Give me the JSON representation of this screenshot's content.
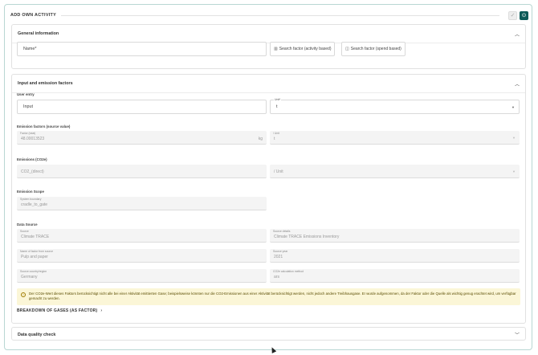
{
  "header": {
    "title": "ADD OWN ACTIVITY",
    "check_icon": "check-icon",
    "save_icon": "save-icon"
  },
  "general": {
    "title": "General information",
    "name_placeholder": "Name*",
    "search_activity_label": "Search factor (activity based)",
    "search_spend_label": "Search factor (spend based)"
  },
  "input_emission": {
    "title": "Input and emission factors",
    "user_entry": {
      "label": "User entry",
      "input_value": "Input",
      "unit_label": "Unit*",
      "unit_value": "t"
    },
    "emission_factors": {
      "label": "Emission factors (source value)",
      "factor_label": "Factor (total)",
      "factor_value": "48.00013523",
      "factor_unit": "kg",
      "per_unit_label": "/ Unit",
      "per_unit_value": "t"
    },
    "emissions": {
      "label": "Emissions (CO2e)",
      "co2_placeholder": "CO2_(direct)",
      "per_unit_placeholder": "/ Unit"
    },
    "scope": {
      "label": "Emission Scope",
      "boundary_label": "System boundary",
      "boundary_value": "cradle_to_gate"
    },
    "data_source": {
      "label": "Data Source",
      "source_label": "Source",
      "source_value": "Climate TRACE",
      "details_label": "Source details",
      "details_value": "Climate TRACE Emissions Inventory",
      "factor_name_label": "Name of factor from source",
      "factor_name_value": "Pulp and paper",
      "year_label": "Source year",
      "year_value": "2021",
      "country_label": "Source country/region",
      "country_value": "Germany",
      "method_label": "CO2e calculation method",
      "method_value": "ars"
    },
    "notice": "Der CO2e-Wert dieses Faktors berücksichtigt nicht alle bei einer Aktivität emittierten Gase; beispielsweise könnten nur die CO2-Emissionen aus einer Aktivität berücksichtigt werden, nicht jedoch andere Treibhausgase. Er wurde aufgenommen, da der Faktor oder die Quelle als wichtig genug erachtet wird, um verfügbar gemacht zu werden.",
    "breakdown_label": "BREAKDOWN OF GASES (AS FACTOR)"
  },
  "quality": {
    "title": "Data quality check"
  }
}
